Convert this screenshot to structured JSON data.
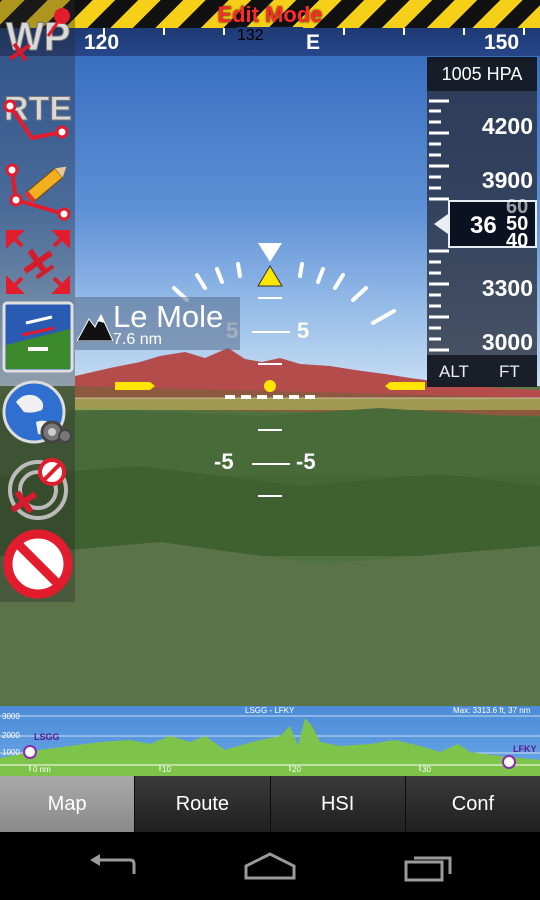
{
  "banner": {
    "mode": "Edit Mode"
  },
  "heading": {
    "left_label": "120",
    "current": "132",
    "cardinal": "E",
    "right_label": "150"
  },
  "poi": {
    "name": "Le Mole",
    "distance": "7.6 nm"
  },
  "pitch_ladder": {
    "upper_left": "5",
    "upper_right": "5",
    "lower_left": "-5",
    "lower_right": "-5"
  },
  "altimeter": {
    "pressure": "1005 HPA",
    "labels": [
      "4200",
      "3900",
      "3300",
      "3000"
    ],
    "current_main": "36",
    "roll_values": [
      "60",
      "50",
      "40"
    ],
    "unit_left": "ALT",
    "unit_right": "FT"
  },
  "profile": {
    "route": "LSGG - LFKY",
    "max": "Max: 3313.6 ft, 37 nm",
    "y_labels": [
      "3000",
      "2000",
      "1000"
    ],
    "x_labels": [
      "0 nm",
      "10",
      "20",
      "30"
    ],
    "from": "LSGG",
    "to": "LFKY"
  },
  "tabs": [
    {
      "label": "Map",
      "active": true
    },
    {
      "label": "Route",
      "active": false
    },
    {
      "label": "HSI",
      "active": false
    },
    {
      "label": "Conf",
      "active": false
    }
  ],
  "toolbar": {
    "buttons": [
      "waypoint-edit-icon",
      "route-edit-icon",
      "route-draw-icon",
      "zoom-plane-icon",
      "synthetic-vision-icon",
      "globe-settings-icon",
      "no-target-icon",
      "prohibited-icon"
    ]
  },
  "colors": {
    "accent": "#f6cf18",
    "mode_text": "#ff2a2a",
    "tab_active": "#9a9a9a"
  }
}
